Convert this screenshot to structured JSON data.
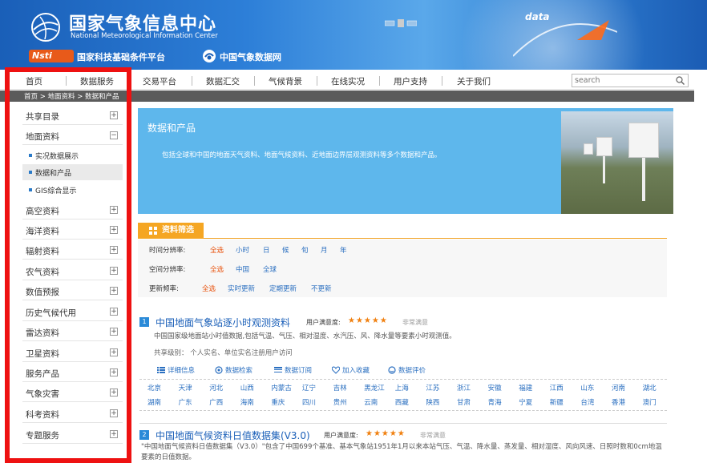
{
  "header": {
    "title_cn": "国家气象信息中心",
    "title_en": "National Meteorological Information Center",
    "nsti_badge": "Nsti",
    "platform": "国家科技基础条件平台",
    "cma": "中国气象数据网",
    "data_word": "data"
  },
  "nav": {
    "items": [
      "首页",
      "数据服务",
      "交易平台",
      "数据汇交",
      "气候背景",
      "在线实况",
      "用户支持",
      "关于我们"
    ],
    "search_placeholder": "search"
  },
  "breadcrumb": "首页 > 地面资料 > 数据和产品",
  "sidebar": {
    "items": [
      {
        "label": "共享目录",
        "toggle": "+"
      },
      {
        "label": "地面资料",
        "toggle": "−"
      },
      {
        "label": "高空资料",
        "toggle": "+"
      },
      {
        "label": "海洋资料",
        "toggle": "+"
      },
      {
        "label": "辐射资料",
        "toggle": "+"
      },
      {
        "label": "农气资料",
        "toggle": "+"
      },
      {
        "label": "数值预报",
        "toggle": "+"
      },
      {
        "label": "历史气候代用",
        "toggle": "+"
      },
      {
        "label": "雷达资料",
        "toggle": "+"
      },
      {
        "label": "卫星资料",
        "toggle": "+"
      },
      {
        "label": "服务产品",
        "toggle": "+"
      },
      {
        "label": "气象灾害",
        "toggle": "+"
      },
      {
        "label": "科考资料",
        "toggle": "+"
      },
      {
        "label": "专题服务",
        "toggle": "+"
      }
    ],
    "subitems": [
      "实况数据展示",
      "数据和产品",
      "GIS综合显示"
    ]
  },
  "hero": {
    "title": "数据和产品",
    "desc": "包括全球和中国的地面天气资料、地面气候资料、近地面边界层观测资料等多个数据和产品。"
  },
  "filter": {
    "tag": "资料筛选",
    "rows": [
      {
        "label": "时间分辨率:",
        "options": [
          "全选",
          "小时",
          "日",
          "候",
          "旬",
          "月",
          "年"
        ]
      },
      {
        "label": "空间分辨率:",
        "options": [
          "全选",
          "中国",
          "全球"
        ]
      },
      {
        "label": "更新频率:",
        "options": [
          "全选",
          "实时更新",
          "定期更新",
          "不更新"
        ]
      }
    ]
  },
  "items": [
    {
      "num": "1",
      "title": "中国地面气象站逐小时观测资料",
      "satisfy_label": "用户满意度:",
      "stars": "★★★★★",
      "level": "非常满意",
      "desc": "中国国家级地面站小时值数据,包括气温、气压、相对湿度、水汽压、风、降水量等要素小时观测值。",
      "share": "共享级别：  个人实名、单位实名注册用户访问"
    },
    {
      "num": "2",
      "title": "中国地面气候资料日值数据集(V3.0)",
      "satisfy_label": "用户满意度:",
      "stars": "★★★★★",
      "level": "非常满意",
      "desc": "\"中国地面气候资料日值数据集（V3.0）\"包含了中国699个基准、基本气象站1951年1月以来本站气压、气温、降水量、蒸发量、相对湿度、风向风速、日照时数和0cm地温要素的日值数据。"
    }
  ],
  "actions": [
    "详细信息",
    "数据检索",
    "数据订阅",
    "加入收藏",
    "数据评价"
  ],
  "regions": [
    [
      "北京",
      "天津",
      "河北",
      "山西",
      "内蒙古",
      "辽宁",
      "吉林",
      "黑龙江",
      "上海",
      "江苏",
      "浙江",
      "安徽",
      "福建",
      "江西",
      "山东",
      "河南",
      "湖北"
    ],
    [
      "湖南",
      "广东",
      "广西",
      "海南",
      "重庆",
      "四川",
      "贵州",
      "云南",
      "西藏",
      "陕西",
      "甘肃",
      "青海",
      "宁夏",
      "新疆",
      "台湾",
      "香港",
      "澳门"
    ]
  ],
  "colors": {
    "frame": "#ee1111",
    "hero": "#5eb7ec",
    "filter": "#f5a623",
    "link": "#2a6fc0",
    "star": "#f08010"
  }
}
